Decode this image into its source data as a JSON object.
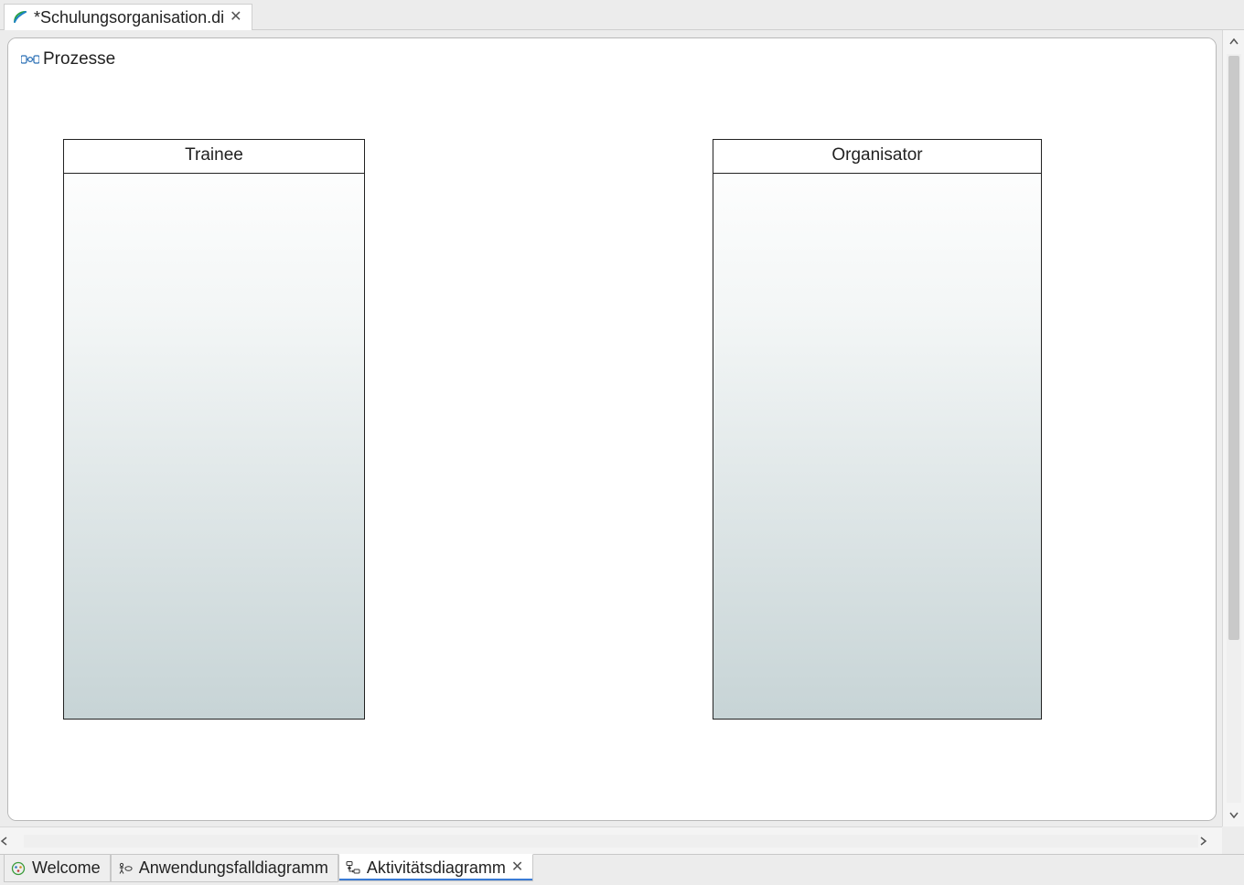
{
  "file_tab": {
    "title": "*Schulungsorganisation.di"
  },
  "diagram": {
    "title": "Prozesse",
    "lanes": [
      {
        "name": "Trainee"
      },
      {
        "name": "Organisator"
      }
    ]
  },
  "inner_tabs": {
    "items": [
      {
        "label": "Welcome",
        "icon": "welcome",
        "active": false,
        "closable": false
      },
      {
        "label": "Anwendungsfalldiagramm",
        "icon": "usecase",
        "active": false,
        "closable": false
      },
      {
        "label": "Aktivitätsdiagramm",
        "icon": "activity",
        "active": true,
        "closable": true
      }
    ]
  }
}
